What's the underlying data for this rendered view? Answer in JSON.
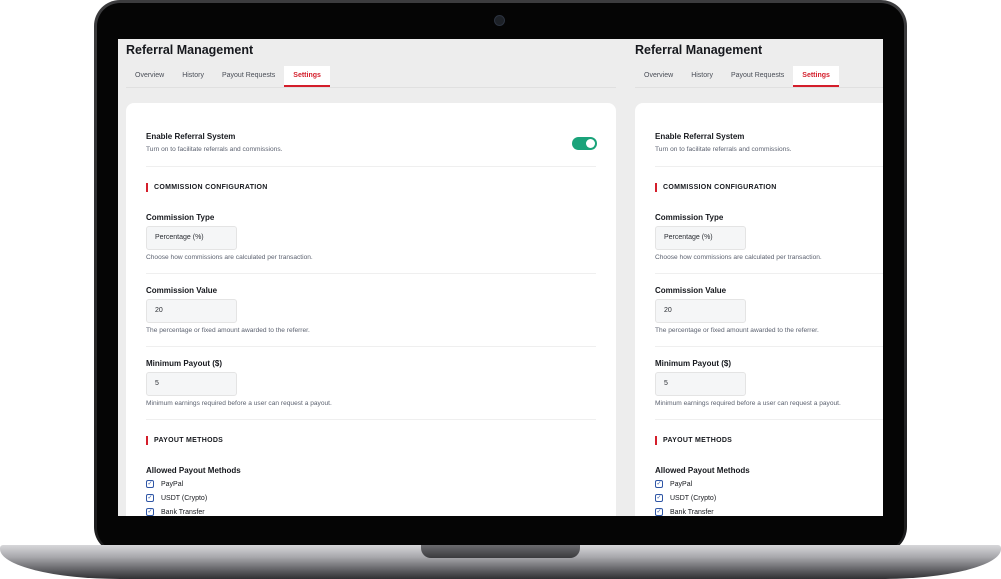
{
  "app": {
    "title": "Referral Management",
    "tabs": [
      {
        "label": "Overview"
      },
      {
        "label": "History"
      },
      {
        "label": "Payout Requests"
      },
      {
        "label": "Settings"
      }
    ],
    "active_tab": "Settings"
  },
  "settings": {
    "enable": {
      "label": "Enable Referral System",
      "help": "Turn on to facilitate referrals and commissions.",
      "on": true
    },
    "commission_section": "COMMISSION CONFIGURATION",
    "commission_type": {
      "label": "Commission Type",
      "value": "Percentage (%)",
      "help": "Choose how commissions are calculated per transaction."
    },
    "commission_value": {
      "label": "Commission Value",
      "value": "20",
      "help": "The percentage or fixed amount awarded to the referrer."
    },
    "minimum_payout": {
      "label": "Minimum Payout ($)",
      "value": "5",
      "help": "Minimum earnings required before a user can request a payout."
    },
    "payout_section": "PAYOUT METHODS",
    "allowed_methods": {
      "label": "Allowed Payout Methods",
      "items": [
        {
          "label": "PayPal",
          "checked": true
        },
        {
          "label": "USDT (Crypto)",
          "checked": true
        },
        {
          "label": "Bank Transfer",
          "checked": true
        }
      ]
    }
  },
  "colors": {
    "accent": "#d41e2b",
    "toggle_on": "#1aa37a",
    "checkbox": "#2f56a6"
  }
}
